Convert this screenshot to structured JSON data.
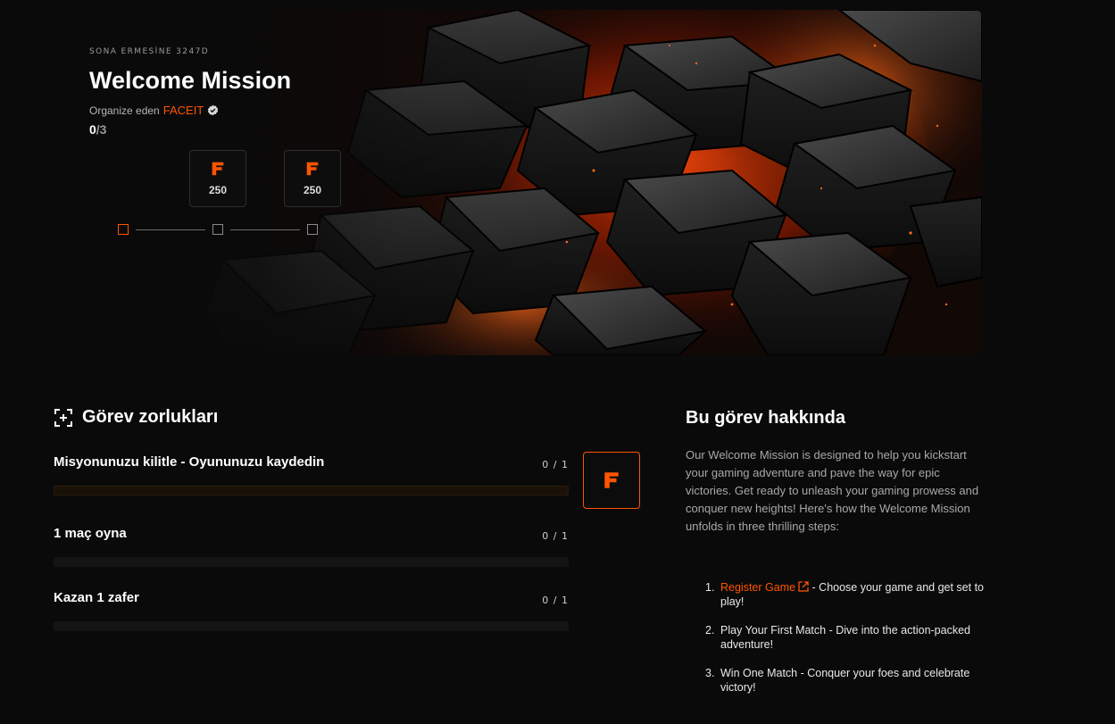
{
  "hero": {
    "expiry": "SONA ERMESİNE 3247D",
    "title": "Welcome Mission",
    "organizer_label": "Organize eden",
    "organizer_name": "FACEIT",
    "progress_current": "0",
    "progress_total": "/3",
    "rewards": [
      {
        "icon": "faceit-points-icon",
        "amount": "250"
      },
      {
        "icon": "faceit-points-icon",
        "amount": "250"
      }
    ],
    "steps_total": 3,
    "steps_active": 1
  },
  "challenges": {
    "title": "Görev zorlukları",
    "items": [
      {
        "name": "Misyonunuzu kilitle - Oyununuzu kaydedin",
        "count": "0 / 1",
        "progress": 0
      },
      {
        "name": "1 maç oyna",
        "count": "0 / 1",
        "progress": 0
      },
      {
        "name": "Kazan 1 zafer",
        "count": "0 / 1",
        "progress": 0
      }
    ],
    "reward_icon": "faceit-logo-icon"
  },
  "about": {
    "title": "Bu görev hakkında",
    "description": "Our Welcome Mission is designed to help you kickstart your gaming adventure and pave the way for epic victories. Get ready to unleash your gaming prowess and conquer new heights! Here's how the Welcome Mission unfolds in three thrilling steps:",
    "steps": [
      {
        "num": "1.",
        "link": "Register Game",
        "text": " - Choose your game and get set to play!"
      },
      {
        "num": "2.",
        "link": "",
        "text": "Play Your First Match - Dive into the action-packed adventure!"
      },
      {
        "num": "3.",
        "link": "",
        "text": "Win One Match - Conquer your foes and celebrate victory!"
      }
    ]
  },
  "colors": {
    "accent": "#ff5500",
    "background": "#0a0a0a"
  }
}
